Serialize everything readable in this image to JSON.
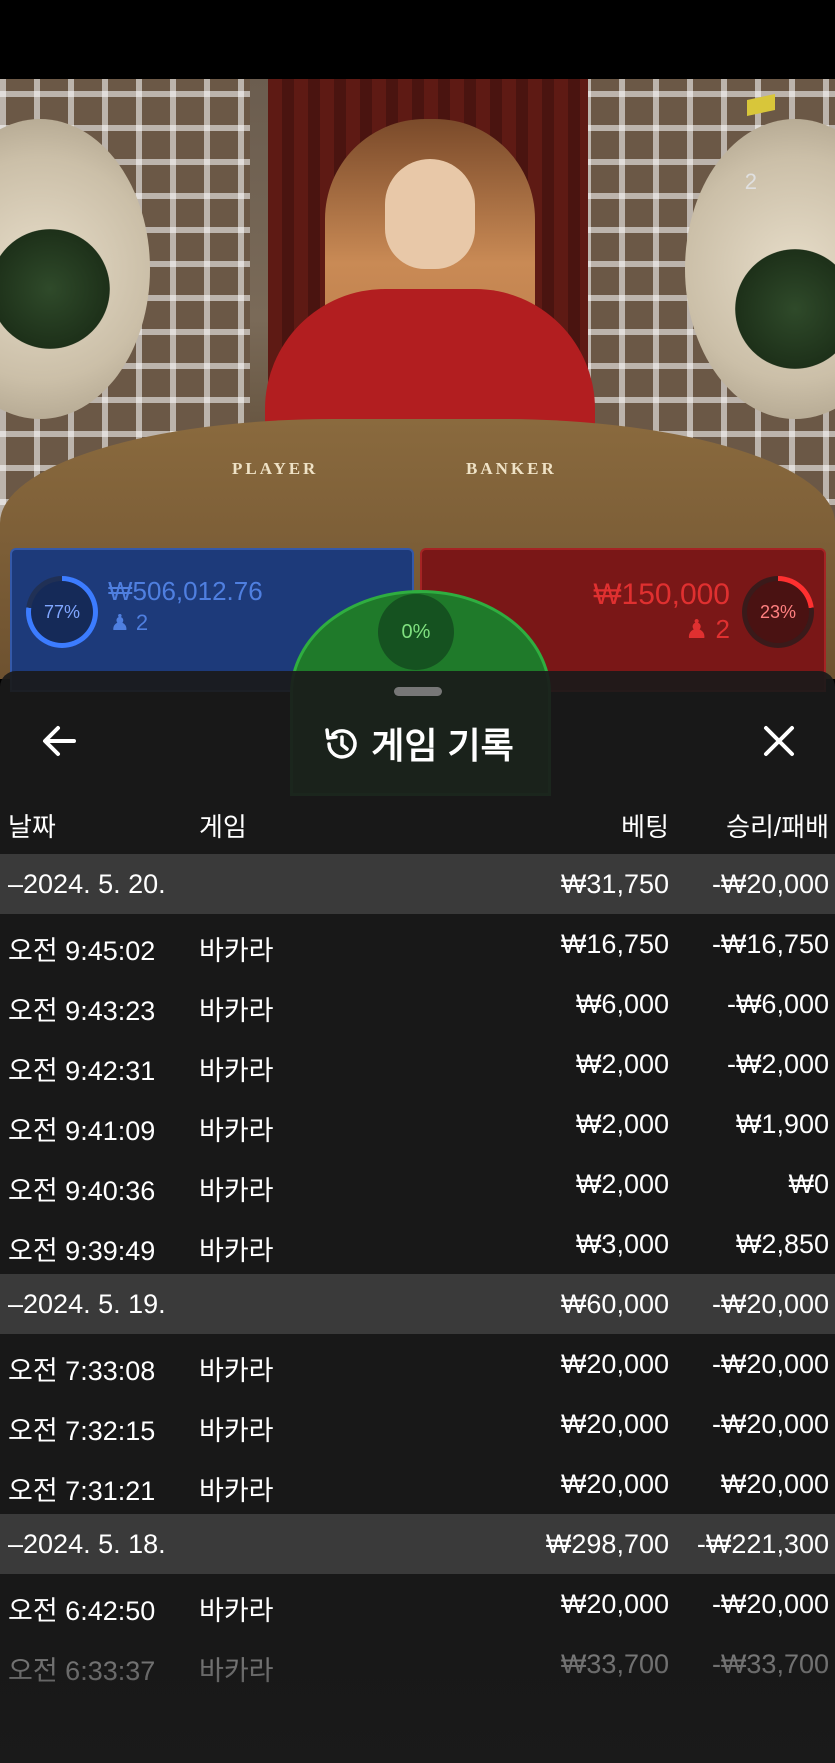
{
  "video": {
    "seat_count": "2",
    "table_player_label": "PLAYER",
    "table_banker_label": "BANKER"
  },
  "bets": {
    "player": {
      "percent": "77%",
      "amount": "₩506,012.76",
      "players": "2",
      "color": "#3c7cff"
    },
    "tie": {
      "percent": "0%",
      "color": "#2fae40"
    },
    "banker": {
      "percent": "23%",
      "amount": "₩150,000",
      "players": "2",
      "color": "#e03030"
    }
  },
  "sheet": {
    "title": "게임 기록",
    "back_icon": "arrow-left-icon",
    "history_icon": "history-clock-icon",
    "close_icon": "close-icon",
    "columns": {
      "date": "날짜",
      "game": "게임",
      "bet": "베팅",
      "win_loss": "승리/패배"
    },
    "groups": [
      {
        "date": "–2024. 5. 20.",
        "bet": "₩31,750",
        "win_loss": "-₩20,000",
        "items": [
          {
            "time": "오전 9:45:02",
            "game": "바카라",
            "bet": "₩16,750",
            "win_loss": "-₩16,750"
          },
          {
            "time": "오전 9:43:23",
            "game": "바카라",
            "bet": "₩6,000",
            "win_loss": "-₩6,000"
          },
          {
            "time": "오전 9:42:31",
            "game": "바카라",
            "bet": "₩2,000",
            "win_loss": "-₩2,000"
          },
          {
            "time": "오전 9:41:09",
            "game": "바카라",
            "bet": "₩2,000",
            "win_loss": "₩1,900"
          },
          {
            "time": "오전 9:40:36",
            "game": "바카라",
            "bet": "₩2,000",
            "win_loss": "₩0"
          },
          {
            "time": "오전 9:39:49",
            "game": "바카라",
            "bet": "₩3,000",
            "win_loss": "₩2,850"
          }
        ]
      },
      {
        "date": "–2024. 5. 19.",
        "bet": "₩60,000",
        "win_loss": "-₩20,000",
        "items": [
          {
            "time": "오전 7:33:08",
            "game": "바카라",
            "bet": "₩20,000",
            "win_loss": "-₩20,000"
          },
          {
            "time": "오전 7:32:15",
            "game": "바카라",
            "bet": "₩20,000",
            "win_loss": "-₩20,000"
          },
          {
            "time": "오전 7:31:21",
            "game": "바카라",
            "bet": "₩20,000",
            "win_loss": "₩20,000"
          }
        ]
      },
      {
        "date": "–2024. 5. 18.",
        "bet": "₩298,700",
        "win_loss": "-₩221,300",
        "items": [
          {
            "time": "오전 6:42:50",
            "game": "바카라",
            "bet": "₩20,000",
            "win_loss": "-₩20,000"
          },
          {
            "time": "오전 6:33:37",
            "game": "바카라",
            "bet": "₩33,700",
            "win_loss": "-₩33,700"
          }
        ]
      }
    ]
  }
}
